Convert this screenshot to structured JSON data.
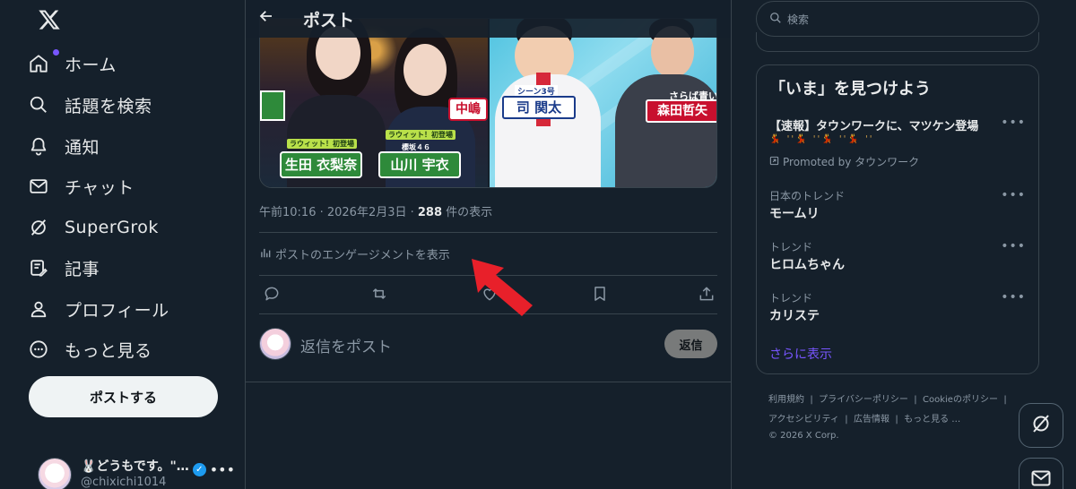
{
  "nav": {
    "logo_icon": "x-logo-icon",
    "items": [
      {
        "label": "ホーム",
        "icon": "home-icon"
      },
      {
        "label": "話題を検索",
        "icon": "search-icon"
      },
      {
        "label": "通知",
        "icon": "bell-icon"
      },
      {
        "label": "チャット",
        "icon": "mail-icon"
      },
      {
        "label": "SuperGrok",
        "icon": "grok-icon"
      },
      {
        "label": "記事",
        "icon": "article-icon"
      },
      {
        "label": "プロフィール",
        "icon": "person-icon"
      },
      {
        "label": "もっと見る",
        "icon": "more-circle-icon"
      }
    ],
    "post_button": "ポストする",
    "account": {
      "name": "🐰どうもです。\"…",
      "handle": "@chixichi1014"
    }
  },
  "post": {
    "header_title": "ポスト",
    "image_captions": {
      "left_name_1": "生田 衣梨奈",
      "left_name_2": "山川 宇衣",
      "left_tag_1": "ラウィット！初登場",
      "left_tag_2": "ラウィット！初登場",
      "left_sub_2": "櫻坂４６",
      "left_partial": "中嶋",
      "right_name_1": "司 関太",
      "right_tag_1": "シーン3号",
      "right_name_2": "森田哲矢",
      "right_tag_2": "さらば青い"
    },
    "timestamp": "午前10:16 · 2026年2月3日 · ",
    "views_count": "288",
    "views_suffix": " 件の表示",
    "engagement_link": "ポストのエンゲージメントを表示",
    "actions": [
      "reply-icon",
      "repost-icon",
      "like-icon",
      "bookmark-icon",
      "share-icon"
    ],
    "reply_placeholder": "返信をポスト",
    "reply_button": "返信"
  },
  "sidebar": {
    "search_placeholder": "検索",
    "trends_title": "「いま」を見つけよう",
    "promoted": {
      "title": "【速報】タウンワークに、マツケン登場",
      "emoji_line": "💃 ''💃 ''💃 ''💃 ''",
      "by": "Promoted by タウンワーク"
    },
    "trends": [
      {
        "category": "日本のトレンド",
        "name": "モームリ"
      },
      {
        "category": "トレンド",
        "name": "ヒロムちゃん"
      },
      {
        "category": "トレンド",
        "name": "カリステ"
      }
    ],
    "show_more": "さらに表示",
    "footer_links": [
      "利用規約",
      "|",
      "プライバシーポリシー",
      "|",
      "Cookieのポリシー",
      "|",
      "アクセシビリティ",
      "|",
      "広告情報",
      "|",
      "もっと見る …",
      "© 2026 X Corp."
    ]
  },
  "colors": {
    "background": "#15202b",
    "accent": "#7856ff",
    "border": "#38444d",
    "annotation_arrow": "#e8202a"
  }
}
